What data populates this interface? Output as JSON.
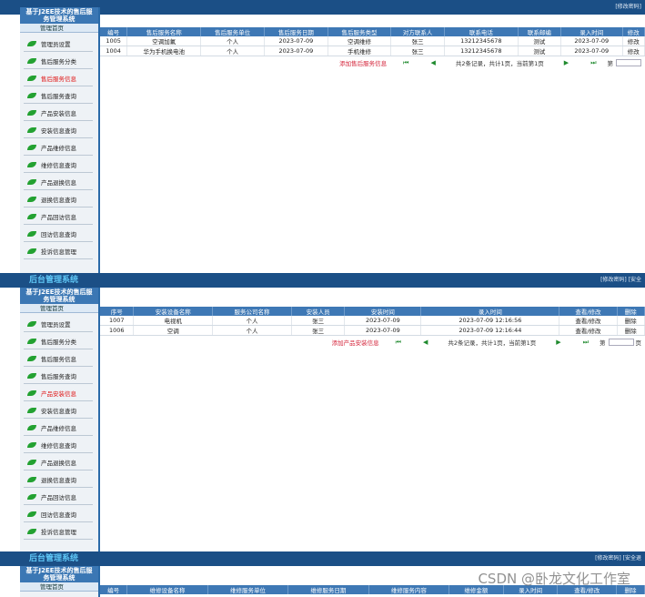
{
  "panel1": {
    "toplinks": "[修改密码]",
    "brand": [
      "基于J2EE技术的售后服",
      "务管理系统"
    ],
    "home": "管理首页",
    "menu": [
      {
        "label": "管理员设置",
        "active": false
      },
      {
        "label": "售后服务分类",
        "active": false
      },
      {
        "label": "售后服务信息",
        "active": true
      },
      {
        "label": "售后服务查询",
        "active": false
      },
      {
        "label": "产品安装信息",
        "active": false
      },
      {
        "label": "安装信息查询",
        "active": false
      },
      {
        "label": "产品维修信息",
        "active": false
      },
      {
        "label": "维修信息查询",
        "active": false
      },
      {
        "label": "产品退换信息",
        "active": false
      },
      {
        "label": "退换信息查询",
        "active": false
      },
      {
        "label": "产品回访信息",
        "active": false
      },
      {
        "label": "回访信息查询",
        "active": false
      },
      {
        "label": "投诉信息管理",
        "active": false
      }
    ],
    "table": {
      "headers": [
        "编号",
        "售后服务名称",
        "售后服务单位",
        "售后服务日期",
        "售后服务类型",
        "对方联系人",
        "联系电话",
        "联系邮编",
        "录入时间",
        "修改"
      ],
      "rows": [
        [
          "1005",
          "空调加氟",
          "个人",
          "2023-07-09",
          "空调维修",
          "张三",
          "13212345678",
          "测试",
          "2023-07-09",
          "修改"
        ],
        [
          "1004",
          "华为手机换电池",
          "个人",
          "2023-07-09",
          "手机维修",
          "张三",
          "13212345678",
          "测试",
          "2023-07-09",
          "修改"
        ]
      ]
    },
    "pager": {
      "add": "添加售后服务信息",
      "info": "共2条记录，共计1页，当前第1页",
      "go": "第"
    }
  },
  "panel2": {
    "sysname": "后台管理系统",
    "toplinks": "[修改密码] [安全",
    "brand": [
      "基于J2EE技术的售后服",
      "务管理系统"
    ],
    "home": "管理首页",
    "menu": [
      {
        "label": "管理员设置",
        "active": false
      },
      {
        "label": "售后服务分类",
        "active": false
      },
      {
        "label": "售后服务信息",
        "active": false
      },
      {
        "label": "售后服务查询",
        "active": false
      },
      {
        "label": "产品安装信息",
        "active": true
      },
      {
        "label": "安装信息查询",
        "active": false
      },
      {
        "label": "产品维修信息",
        "active": false
      },
      {
        "label": "维修信息查询",
        "active": false
      },
      {
        "label": "产品退换信息",
        "active": false
      },
      {
        "label": "退换信息查询",
        "active": false
      },
      {
        "label": "产品回访信息",
        "active": false
      },
      {
        "label": "回访信息查询",
        "active": false
      },
      {
        "label": "投诉信息管理",
        "active": false
      }
    ],
    "table": {
      "headers": [
        "序号",
        "安装设备名称",
        "服务公司名称",
        "安装人员",
        "安装时间",
        "录入时间",
        "查看/修改",
        "删除"
      ],
      "rows": [
        [
          "1007",
          "电视机",
          "个人",
          "张三",
          "2023-07-09",
          "2023-07-09 12:16:56",
          "查看/修改",
          "删除"
        ],
        [
          "1006",
          "空调",
          "个人",
          "张三",
          "2023-07-09",
          "2023-07-09 12:16:44",
          "查看/修改",
          "删除"
        ]
      ]
    },
    "pager": {
      "add": "添加产品安装信息",
      "info": "共2条记录，共计1页，当前第1页",
      "go": "第",
      "suffix": "页"
    }
  },
  "panel3": {
    "sysname": "后台管理系统",
    "toplinks": "[修改密码] [安全退",
    "brand": [
      "基于J2EE技术的售后服",
      "务管理系统"
    ],
    "home": "管理首页",
    "table": {
      "headers": [
        "编号",
        "维修设备名称",
        "维修服务单位",
        "维修服务日期",
        "维修服务内容",
        "维修金额",
        "录入时间",
        "查看/修改",
        "删除"
      ]
    }
  },
  "pager_icons": {
    "first": "⏮",
    "prev": "◀",
    "next": "▶",
    "last": "⏭"
  },
  "watermark": "CSDN @卧龙文化工作室"
}
